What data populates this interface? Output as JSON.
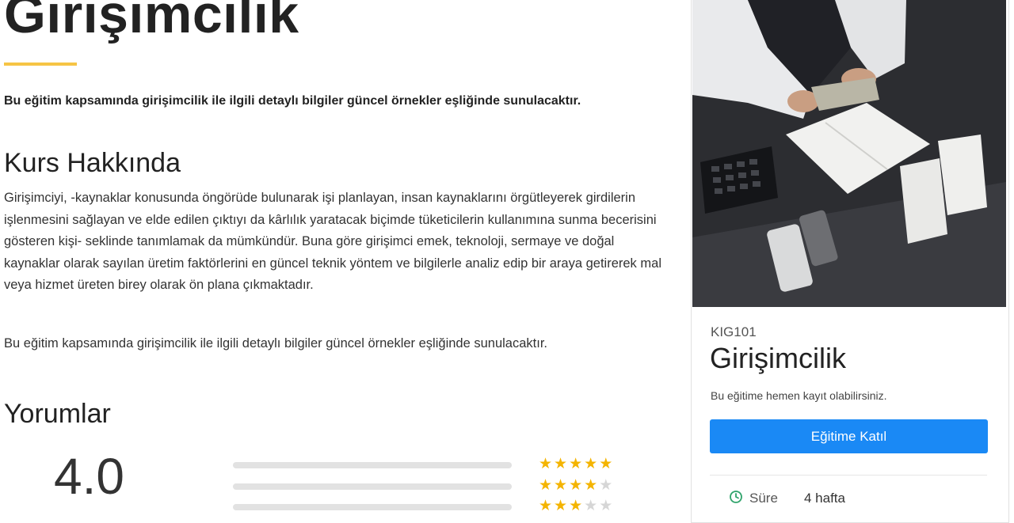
{
  "course": {
    "title": "Girişimcilik",
    "lead": "Bu eğitim kapsamında girişimcilik ile ilgili detaylı bilgiler güncel örnekler eşliğinde sunulacaktır.",
    "about_heading": "Kurs Hakkında",
    "about_paragraph_1": "Girişimciyi, -kaynaklar konusunda öngörüde bulunarak işi planlayan, insan kaynaklarını örgütleyerek girdilerin işlenmesini sağlayan ve elde edilen çıktıyı da kârlılık yaratacak biçimde tüketicilerin kullanımına sunma becerisini gösteren kişi- seklinde tanımlamak da mümkündür. Buna göre girişimci emek, teknoloji, sermaye ve doğal kaynaklar olarak sayılan üretim faktörlerini en güncel teknik yöntem ve bilgilerle analiz edip bir araya getirerek mal veya hizmet üreten birey olarak ön plana çıkmaktadır.",
    "about_paragraph_2": "Bu eğitim kapsamında girişimcilik ile ilgili detaylı bilgiler güncel örnekler eşliğinde sunulacaktır."
  },
  "reviews": {
    "heading": "Yorumlar",
    "average": "4.0",
    "rows": [
      {
        "stars": 5,
        "fraction": 0.0
      },
      {
        "stars": 4,
        "fraction": 0.0
      },
      {
        "stars": 3,
        "fraction": 0.0
      }
    ]
  },
  "sidebar": {
    "code": "KIG101",
    "title": "Girişimcilik",
    "subtitle": "Bu eğitime hemen kayıt olabilirsiniz.",
    "enroll_label": "Eğitime Katıl",
    "duration_label": "Süre",
    "duration_value": "4 hafta",
    "duration_icon": "clock-icon"
  },
  "colors": {
    "accent": "#f6c445",
    "button": "#1a89f5",
    "star": "#f4b400",
    "icon": "#2fa36b"
  }
}
